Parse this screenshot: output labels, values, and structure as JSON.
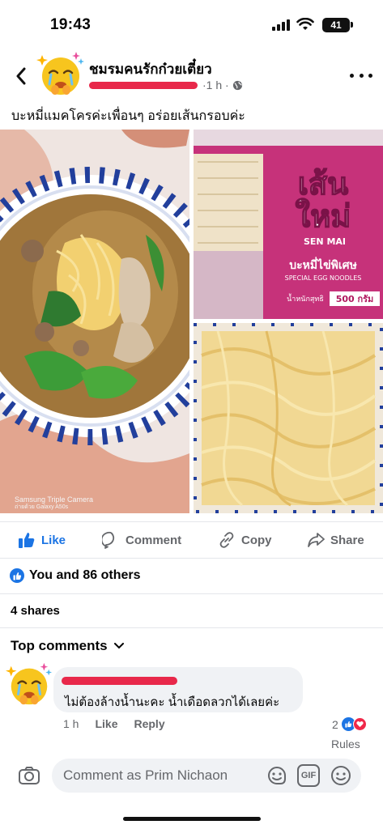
{
  "status_bar": {
    "time": "19:43",
    "battery": "41",
    "icons": [
      "cellular-signal-icon",
      "wifi-icon",
      "battery-icon"
    ]
  },
  "post": {
    "group_name": "ชมรมคนรักก๋วยเตี๋ยว",
    "time": "1 h",
    "audience_icon": "globe-icon",
    "caption": "บะหมี่แมคโครค่ะเพื่อนๆ อร่อยเส้นกรอบค่ะ",
    "photo_watermark": [
      "Samsung Triple Camera",
      "ถ่ายด้วย Galaxy A50s"
    ],
    "package": {
      "title_line1": "เส้น",
      "title_line2": "ใหม่",
      "brand": "SEN MAI",
      "product": "บะหมี่ไข่พิเศษ",
      "product_en": "SPECIAL EGG NOODLES",
      "weight": "500 กรัม",
      "weight_label": "น้ำหนักสุทธิ"
    }
  },
  "actions": {
    "like": "Like",
    "comment": "Comment",
    "copy": "Copy",
    "share": "Share"
  },
  "reactions": {
    "summary": "You and 86 others"
  },
  "shares": "4 shares",
  "comments_header": "Top comments",
  "comment": {
    "text": "ไม่ต้องล้างน้ำนะคะ  น้ำเดือดลวกได้เลยค่ะ",
    "time": "1 h",
    "like": "Like",
    "reply": "Reply",
    "reaction_count": "2"
  },
  "rules": "Rules",
  "composer": {
    "placeholder": "Comment as Prim Nichaon",
    "gif": "GIF"
  },
  "colors": {
    "accent": "#1b74e4",
    "redaction": "#e8284a",
    "love": "#f02849",
    "package_pink": "#c23a78"
  }
}
